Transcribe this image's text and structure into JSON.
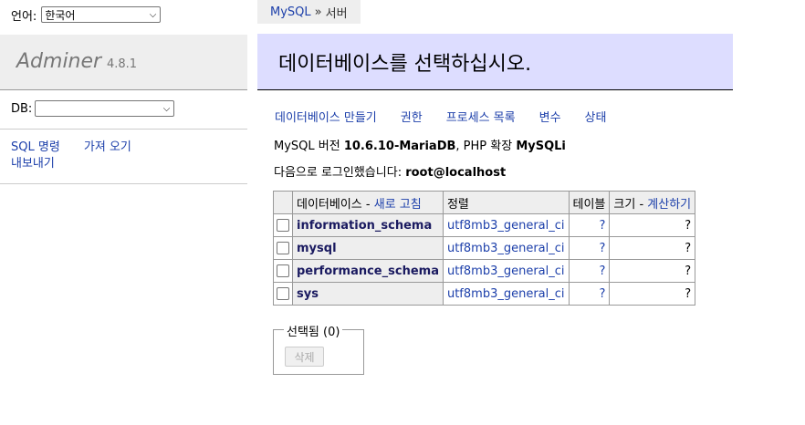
{
  "lang": {
    "label": "언어:",
    "selected": "한국어"
  },
  "breadcrumb": {
    "server_type": "MySQL",
    "separator": "»",
    "current": "서버"
  },
  "logo": {
    "name": "Adminer",
    "version": "4.8.1"
  },
  "db_select": {
    "label": "DB:",
    "selected": ""
  },
  "sidebar_links": {
    "sql": "SQL 명령",
    "import": "가져 오기",
    "export": "내보내기"
  },
  "heading": "데이터베이스를 선택하십시오.",
  "actions": {
    "create_db": "데이터베이스 만들기",
    "privileges": "권한",
    "processlist": "프로세스 목록",
    "variables": "변수",
    "status": "상태"
  },
  "info": {
    "version_prefix": "MySQL 버전",
    "version_value": "10.6.10-MariaDB",
    "ext_prefix": ", PHP 확장",
    "ext_value": "MySQLi",
    "login_prefix": "다음으로 로그인했습니다:",
    "login_user": "root@localhost"
  },
  "table": {
    "headers": {
      "database": "데이터베이스",
      "dash": " - ",
      "refresh": "새로 고침",
      "collation": "정렬",
      "tables": "테이블",
      "size": "크기",
      "compute": "계산하기"
    },
    "rows": [
      {
        "name": "information_schema",
        "collation": "utf8mb3_general_ci",
        "tables": "?",
        "size": "?"
      },
      {
        "name": "mysql",
        "collation": "utf8mb3_general_ci",
        "tables": "?",
        "size": "?"
      },
      {
        "name": "performance_schema",
        "collation": "utf8mb3_general_ci",
        "tables": "?",
        "size": "?"
      },
      {
        "name": "sys",
        "collation": "utf8mb3_general_ci",
        "tables": "?",
        "size": "?"
      }
    ]
  },
  "selected": {
    "legend": "선택됨 (0)",
    "delete_button": "삭제"
  }
}
